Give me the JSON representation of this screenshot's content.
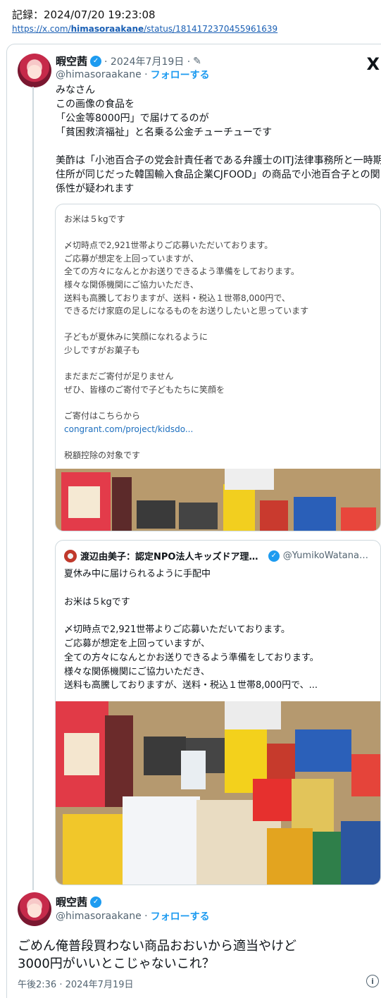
{
  "record": {
    "label": "記録：2024/07/20 19:23:08",
    "url_prefix": "https://x.com/",
    "url_user": "himasoraakane",
    "url_suffix": "/status/1814172370455961639"
  },
  "main_tweet": {
    "name": "暇空茜",
    "date": "· 2024年7月19日 ·",
    "handle": "@himasoraakane ·",
    "follow_label": "フォローする",
    "logo": "X",
    "text": "みなさん\nこの画像の食品を\n「公金等8000円」で届けてるのが\n「貧困救済福祉」と名乗る公金チューチューです\n\n美酢は「小池百合子の党会計責任者である弁護士のITJ法律事務所と一時期住所が同じだった韓国輸入食品企業CJFOOD」の商品で小池百合子との関係性が疑われます",
    "embed_text": "お米は５kgです\n\n〆切時点で2,921世帯よりご応募いただいております。\nご応募が想定を上回っていますが、\n全ての方々になんとかお送りできるよう準備をしております。\n様々な関係機関にご協力いただき、\n送料も高騰しておりますが、送料・税込１世帯8,000円で、\nできるだけ家庭の足しになるものをお送りしたいと思っています\n\n子どもが夏休みに笑顔になれるように\n少しですがお菓子も\n\nまだまだご寄付が足りません\nぜひ、皆様のご寄付で子どもたちに笑顔を\n\nご寄付はこちらから",
    "embed_link": "congrant.com/project/kidsdo...",
    "embed_footer": "税額控除の対象です"
  },
  "quote_tweet": {
    "name": "渡辺由美子：認定NPO法人キッズドア理事長",
    "handle": "@YumikoWatanabe_",
    "text": "夏休み中に届けられるように手配中\n\nお米は５kgです\n\n〆切時点で2,921世帯よりご応募いただいております。\nご応募が想定を上回っていますが、\n全ての方々になんとかお送りできるよう準備をしております。\n様々な関係機関にご協力いただき、\n送料も高騰しておりますが、送料・税込１世帯8,000円で、..."
  },
  "reply_tweet": {
    "name": "暇空茜",
    "handle": "@himasoraakane ·",
    "follow_label": "フォローする",
    "text": "ごめん俺普段買わない商品おおいから適当やけど\n3000円がいいとこじゃないこれ？",
    "meta": "午後2:36 · 2024年7月19日"
  },
  "colors": {
    "link": "#1d9bf0",
    "border": "#cfd9de",
    "muted": "#536471"
  }
}
